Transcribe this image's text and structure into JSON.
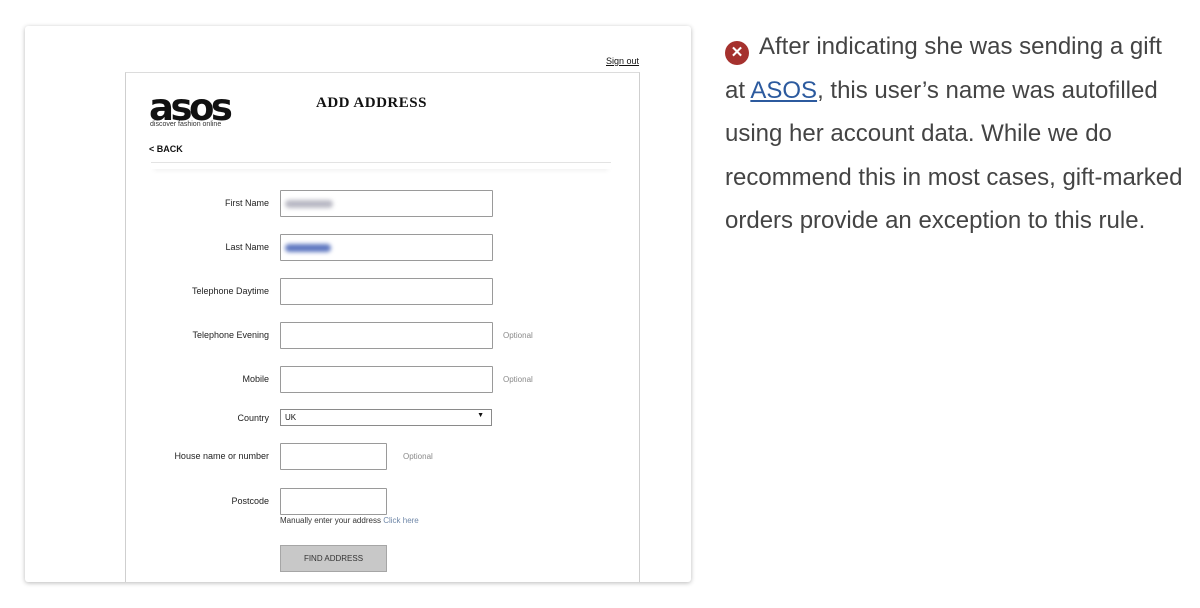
{
  "screenshot": {
    "sign_out": "Sign out",
    "logo": {
      "wordmark": "asos",
      "tagline": "discover fashion online"
    },
    "title": "ADD ADDRESS",
    "back": "< BACK",
    "form": {
      "first_name_label": "First Name",
      "last_name_label": "Last Name",
      "tel_day_label": "Telephone Daytime",
      "tel_eve_label": "Telephone Evening",
      "tel_eve_optional": "Optional",
      "mobile_label": "Mobile",
      "mobile_optional": "Optional",
      "country_label": "Country",
      "country_value": "UK",
      "house_label": "House name or number",
      "house_optional": "Optional",
      "postcode_label": "Postcode",
      "manual_text": "Manually enter your address",
      "manual_link": "Click here",
      "find_button": "FIND ADDRESS"
    }
  },
  "annotation": {
    "icon": "error-x-icon",
    "icon_color": "#a5312e",
    "text_before": "After indicating she was sending a gift at ",
    "link_text": "ASOS",
    "link_color": "#2c5a9e",
    "text_after": ", this user’s name was autofilled using her account data. While we do recommend this in most cases, gift-marked orders provide an exception to this rule."
  }
}
